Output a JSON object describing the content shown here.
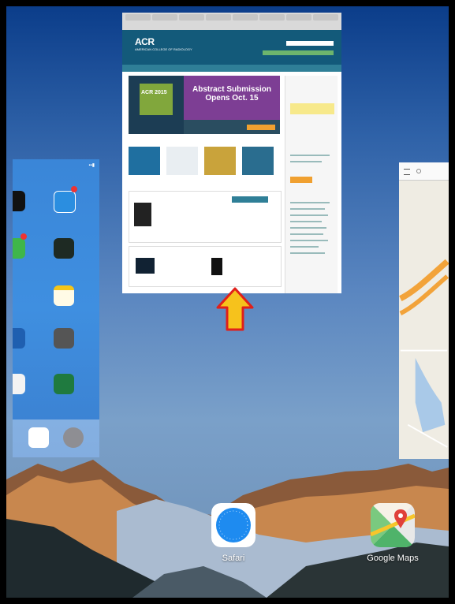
{
  "center_card": {
    "logo_main": "ACR",
    "logo_sub": "AMERICAN COLLEGE OF RADIOLOGY",
    "banner_title_line1": "Abstract Submission",
    "banner_title_line2": "Opens Oct. 15",
    "banner_year": "ACR 2015"
  },
  "dock": {
    "apps": [
      {
        "label": "Safari"
      },
      {
        "label": "Google Maps"
      }
    ]
  },
  "colors": {
    "acr_header": "#135a7a",
    "banner_purple": "#7d3e94",
    "arrow_fill": "#f6c21c",
    "arrow_stroke": "#e0201a"
  }
}
